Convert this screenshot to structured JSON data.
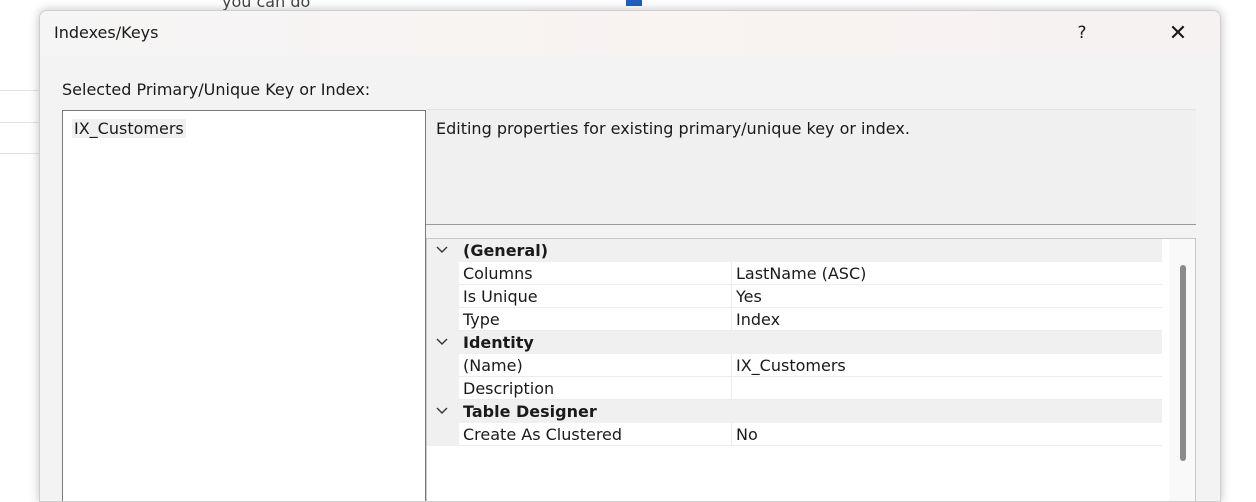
{
  "dialog": {
    "title": "Indexes/Keys",
    "help_label": "?",
    "close_label": "✕"
  },
  "background": {
    "cut_text": "you can do"
  },
  "list": {
    "caption": "Selected Primary/Unique Key or Index:",
    "items": [
      "IX_Customers"
    ]
  },
  "description": {
    "text": "Editing properties for existing primary/unique key or index."
  },
  "properties": {
    "general": {
      "label": "(General)",
      "columns_name": "Columns",
      "columns_value": "LastName (ASC)",
      "is_unique_name": "Is Unique",
      "is_unique_value": "Yes",
      "type_name": "Type",
      "type_value": "Index"
    },
    "identity": {
      "label": "Identity",
      "name_name": "(Name)",
      "name_value": "IX_Customers",
      "description_name": "Description",
      "description_value": ""
    },
    "table_designer": {
      "label": "Table Designer",
      "create_as_clustered_name": "Create As Clustered",
      "create_as_clustered_value": "No"
    }
  },
  "icons": {
    "help": "help-icon",
    "close": "close-icon",
    "expand": "chevron-down-icon"
  },
  "colors": {
    "accent": "#1f5fbf",
    "dialog_bg": "#f3f3f3",
    "category_bg": "#f0f0f0"
  }
}
